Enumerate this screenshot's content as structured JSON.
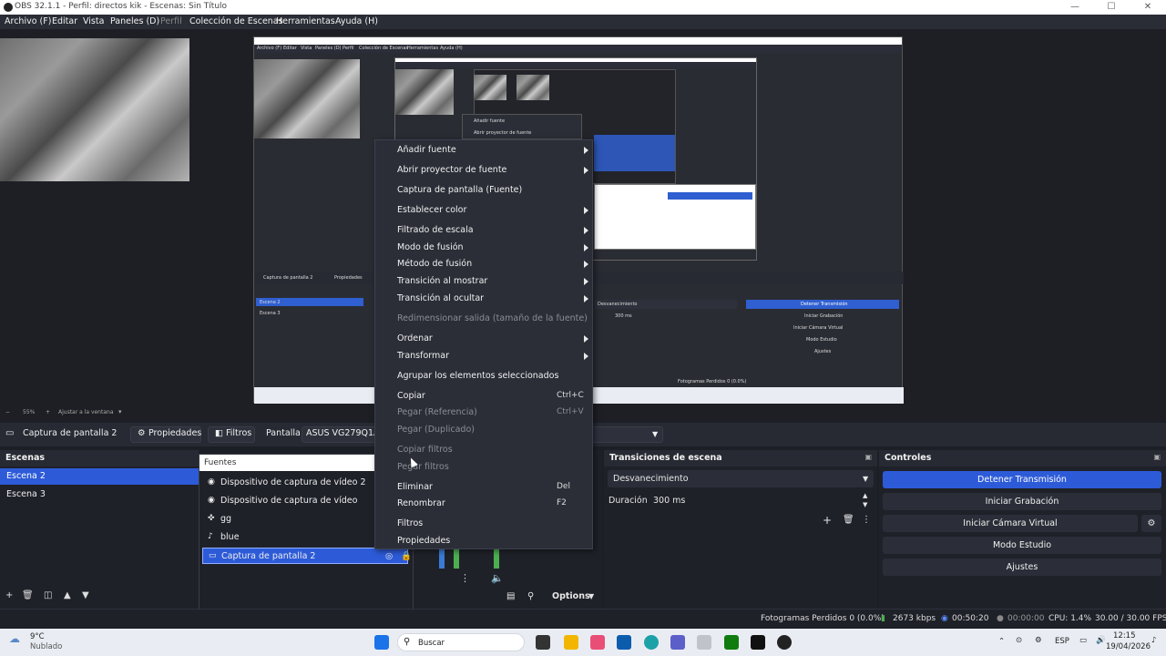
{
  "window": {
    "title": "OBS 32.1.1 - Perfil: directos kik - Escenas: Sin Título",
    "minimize": "—",
    "maximize": "☐",
    "close": "✕"
  },
  "menubar": [
    "Archivo (F)",
    "Editar",
    "Vista",
    "Paneles (D)",
    "Perfil",
    "Colección de Escenas",
    "Herramientas",
    "Ayuda (H)"
  ],
  "preview_zoom": {
    "level": "55%",
    "fit_label": "Ajustar a la ventana"
  },
  "source_toolbar": {
    "source_name": "Captura de pantalla 2",
    "properties": "Propiedades",
    "filters": "Filtros",
    "display_label": "Pantalla",
    "display_value": "ASUS VG279Q1A: 1"
  },
  "scenes": {
    "title": "Escenas",
    "items": [
      {
        "label": "Escena 2",
        "selected": true
      },
      {
        "label": "Escena 3",
        "selected": false
      }
    ]
  },
  "sources": {
    "title": "Fuentes",
    "items": [
      {
        "label": "Dispositivo de captura de vídeo 2",
        "icon": "camera-icon"
      },
      {
        "label": "Dispositivo de captura de vídeo",
        "icon": "camera-icon"
      },
      {
        "label": "gg",
        "icon": "gamepad-icon"
      },
      {
        "label": "blue",
        "icon": "microphone-icon"
      },
      {
        "label": "Captura de pantalla 2",
        "icon": "monitor-icon",
        "selected": true
      }
    ]
  },
  "transitions": {
    "title": "Transiciones de escena",
    "selected": "Desvanecimiento",
    "duration_label": "Duración",
    "duration_value": "300 ms"
  },
  "controls": {
    "title": "Controles",
    "buttons": [
      "Detener Transmisión",
      "Iniciar Grabación",
      "Iniciar Cámara Virtual",
      "Modo Estudio",
      "Ajustes"
    ]
  },
  "mixer_options": "Options",
  "context_menu": {
    "items": [
      {
        "label": "Añadir fuente",
        "submenu": true
      },
      {
        "label": "Abrir proyector de fuente",
        "submenu": true
      },
      {
        "label": "Captura de pantalla (Fuente)"
      },
      {
        "label": "Establecer color",
        "submenu": true
      },
      {
        "label": "Filtrado de escala",
        "submenu": true
      },
      {
        "label": "Modo de fusión",
        "submenu": true
      },
      {
        "label": "Método de fusión",
        "submenu": true
      },
      {
        "label": "Transición al mostrar",
        "submenu": true
      },
      {
        "label": "Transición al ocultar",
        "submenu": true
      },
      {
        "label": "Redimensionar salida (tamaño de la fuente)",
        "disabled": true
      },
      {
        "label": "Ordenar",
        "submenu": true
      },
      {
        "label": "Transformar",
        "submenu": true
      },
      {
        "label": "Agrupar los elementos seleccionados"
      },
      {
        "label": "Copiar",
        "shortcut": "Ctrl+C"
      },
      {
        "label": "Pegar (Referencia)",
        "shortcut": "Ctrl+V",
        "disabled": true
      },
      {
        "label": "Pegar (Duplicado)",
        "disabled": true
      },
      {
        "label": "Copiar filtros",
        "disabled": true
      },
      {
        "label": "Pegar filtros",
        "disabled": true
      },
      {
        "label": "Eliminar",
        "shortcut": "Del"
      },
      {
        "label": "Renombrar",
        "shortcut": "F2"
      },
      {
        "label": "Filtros"
      },
      {
        "label": "Propiedades"
      }
    ]
  },
  "status": {
    "dropped": "Fotogramas Perdidos 0 (0.0%)",
    "bitrate": "2673 kbps",
    "stream_time": "00:50:20",
    "rec_time": "00:00:00",
    "cpu": "CPU: 1.4%",
    "fps": "30.00 / 30.00 FPS"
  },
  "taskbar": {
    "weather_temp": "9°C",
    "weather_desc": "Nublado",
    "search": "Buscar",
    "lang": "ESP",
    "time": "12:15",
    "date": "19/04/2026"
  },
  "mini_capture": {
    "menu": [
      "Archivo (F)",
      "Editar",
      "Vista",
      "Paneles (D)",
      "Perfil",
      "Colección de Escenas",
      "Herramientas",
      "Ayuda (H)"
    ],
    "scenes": [
      "Escena 2",
      "Escena 3"
    ],
    "controls": [
      "Detener Transmisión",
      "Iniciar Grabación",
      "Iniciar Cámara Virtual",
      "Modo Estudio",
      "Ajustes"
    ],
    "transition": "Desvanecimiento",
    "duration": "300 ms",
    "status": "Fotogramas Perdidos 0 (0.0%)",
    "submenu": [
      "Añadir fuente",
      "Abrir proyector de fuente"
    ],
    "src_name": "Captura de pantalla 2",
    "props": "Propiedades"
  }
}
